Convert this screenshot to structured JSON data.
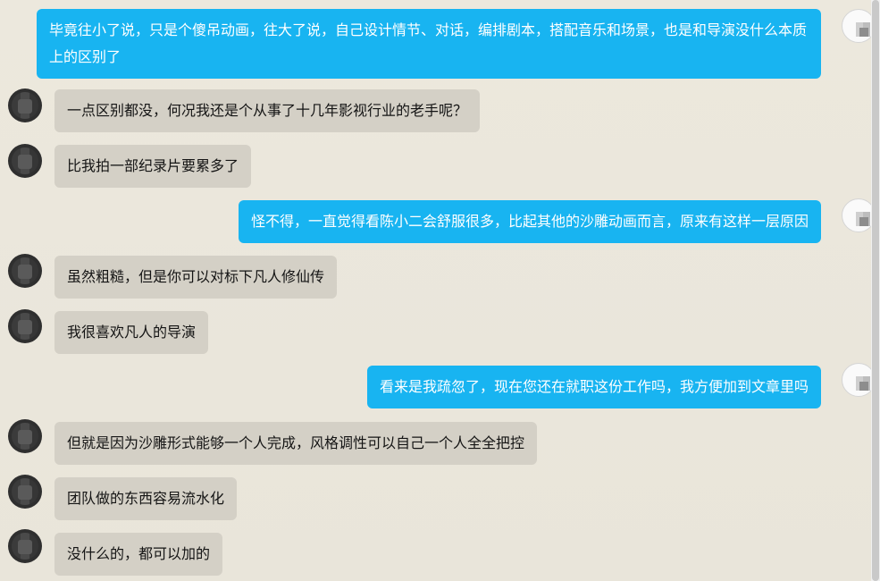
{
  "messages": [
    {
      "sender": "self",
      "text": "毕竟往小了说，只是个傻吊动画，往大了说，自己设计情节、对话，编排剧本，搭配音乐和场景，也是和导演没什么本质上的区别了"
    },
    {
      "sender": "other",
      "text": "一点区别都没，何况我还是个从事了十几年影视行业的老手呢？"
    },
    {
      "sender": "other",
      "text": "比我拍一部纪录片要累多了"
    },
    {
      "sender": "self",
      "text": "怪不得，一直觉得看陈小二会舒服很多，比起其他的沙雕动画而言，原来有这样一层原因"
    },
    {
      "sender": "other",
      "text": "虽然粗糙，但是你可以对标下凡人修仙传"
    },
    {
      "sender": "other",
      "text": "我很喜欢凡人的导演"
    },
    {
      "sender": "self",
      "text": "看来是我疏忽了，现在您还在就职这份工作吗，我方便加到文章里吗"
    },
    {
      "sender": "other",
      "text": "但就是因为沙雕形式能够一个人完成，风格调性可以自己一个人全全把控"
    },
    {
      "sender": "other",
      "text": "团队做的东西容易流水化"
    },
    {
      "sender": "other",
      "text": "没什么的，都可以加的"
    }
  ],
  "colors": {
    "background": "#ebe7dc",
    "self_bubble": "#18b4f1",
    "other_bubble": "#d4d0c6",
    "self_text": "#ffffff",
    "other_text": "#141414"
  }
}
